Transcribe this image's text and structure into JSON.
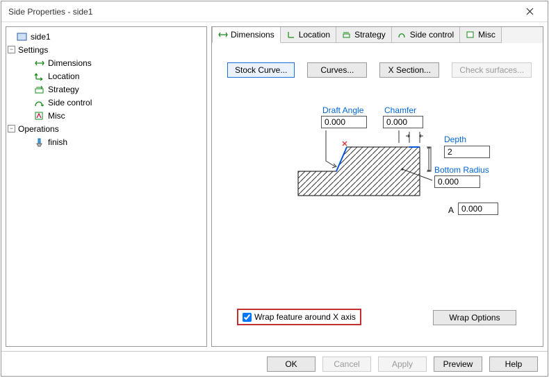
{
  "window": {
    "title": "Side Properties - side1"
  },
  "tree": {
    "root": "side1",
    "settings": "Settings",
    "dimensions": "Dimensions",
    "location": "Location",
    "strategy": "Strategy",
    "side_control": "Side control",
    "misc": "Misc",
    "operations": "Operations",
    "finish": "finish"
  },
  "tabs": {
    "dimensions": "Dimensions",
    "location": "Location",
    "strategy": "Strategy",
    "side_control": "Side control",
    "misc": "Misc"
  },
  "buttons": {
    "stock_curve": "Stock Curve...",
    "curves": "Curves...",
    "x_section": "X Section...",
    "check_surfaces": "Check surfaces...",
    "wrap_options": "Wrap Options"
  },
  "fields": {
    "draft_angle_label": "Draft Angle",
    "draft_angle": "0.000",
    "chamfer_label": "Chamfer",
    "chamfer": "0.000",
    "depth_label": "Depth",
    "depth": "2",
    "bottom_radius_label": "Bottom Radius",
    "bottom_radius": "0.000",
    "a_label": "A",
    "a_value": "0.000"
  },
  "wrap": {
    "checkbox_label": "Wrap feature around X axis",
    "checked": true
  },
  "footer": {
    "ok": "OK",
    "cancel": "Cancel",
    "apply": "Apply",
    "preview": "Preview",
    "help": "Help"
  }
}
